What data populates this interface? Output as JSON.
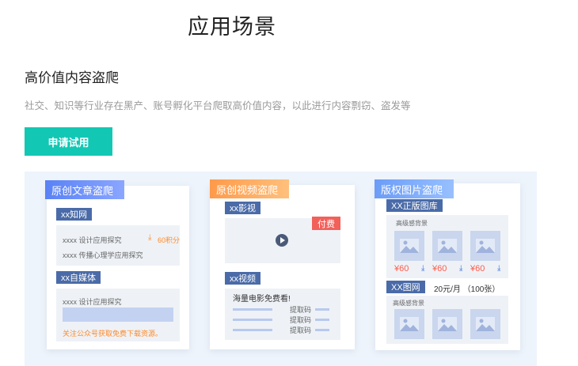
{
  "header": {
    "title": "应用场景"
  },
  "section": {
    "title": "高价值内容盗爬",
    "description": "社交、知识等行业存在黑产、账号孵化平台爬取高价值内容，以此进行内容剽窃、盗发等",
    "apply_label": "申请试用"
  },
  "cards": {
    "article": {
      "tag": "原创文章盗爬",
      "source1": "xx知网",
      "row1_text": "xxxx 设计应用探究",
      "row1_points": "60积分",
      "row2_text": "xxxx 传播心理学应用探究",
      "source2": "xx自媒体",
      "row3_text": "xxxx 设计应用探究",
      "notice": "关注公众号获取免费下载资源。"
    },
    "video": {
      "tag": "原创视频盗爬",
      "source1": "xx影视",
      "paid_badge": "付费",
      "source2": "xx视频",
      "promo": "海量电影免费看!",
      "code1": "提取码",
      "code2": "提取码",
      "code3": "提取码"
    },
    "image": {
      "tag": "版权图片盗爬",
      "source1": "XX正版图库",
      "hd_label1": "高级感背景",
      "price1": "¥60",
      "price2": "¥60",
      "price3": "¥60",
      "source2": "XX图网",
      "subscription": "20元/月 （100张）",
      "hd_label2": "高级感背景"
    }
  },
  "colors": {
    "accent": "#12c8b4",
    "tag_blue": "#5a82f5",
    "tag_orange": "#ff9a4a",
    "price_red": "#ff5a4a",
    "paid_red": "#f2605a"
  },
  "icons": {
    "play": "play-icon",
    "download": "download-icon",
    "image": "image-icon"
  }
}
